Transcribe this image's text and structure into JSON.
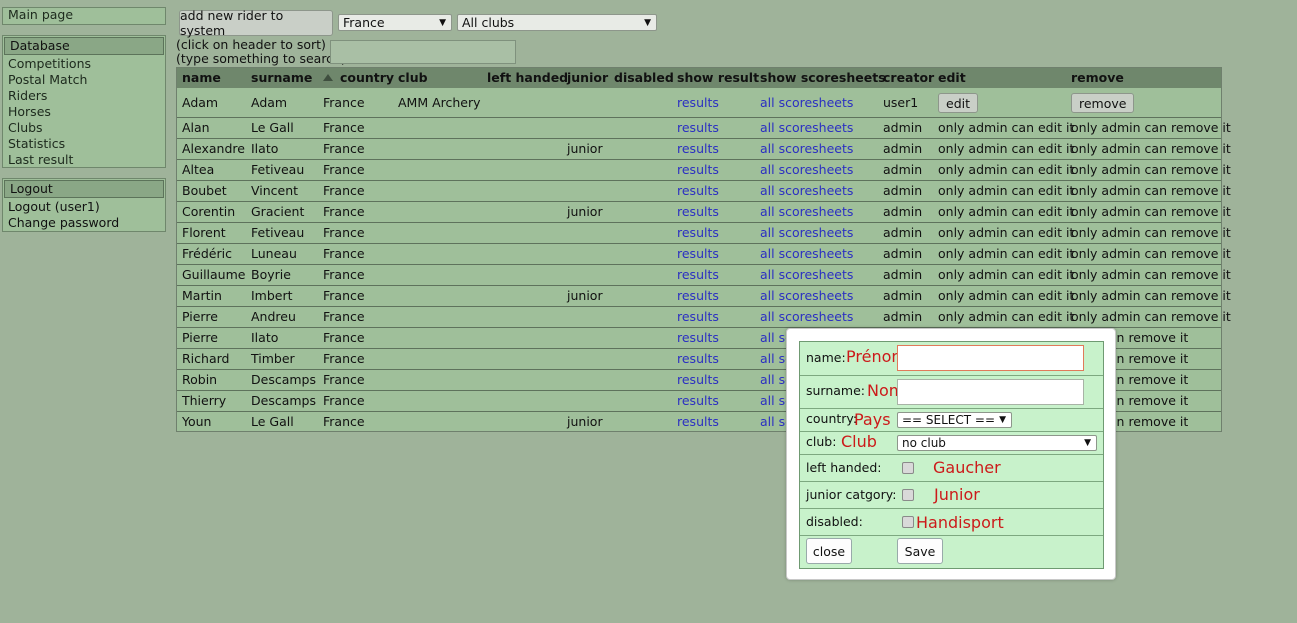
{
  "sidebar": {
    "main": {
      "label": "Main page"
    },
    "database": {
      "header": "Database",
      "items": [
        {
          "label": "Competitions"
        },
        {
          "label": "Postal Match"
        },
        {
          "label": "Riders"
        },
        {
          "label": "Horses"
        },
        {
          "label": "Clubs"
        },
        {
          "label": "Statistics"
        },
        {
          "label": "Last result"
        }
      ]
    },
    "account": {
      "header": "Logout",
      "items": [
        {
          "label": "Logout (user1)"
        },
        {
          "label": "Change password"
        }
      ]
    }
  },
  "toolbar": {
    "add_rider_label": "add new rider to system",
    "country_filter": "France",
    "club_filter": "All clubs",
    "sort_hint": "(click on header to sort)",
    "search_hint": "(type something to search)",
    "search_value": ""
  },
  "table": {
    "headers": {
      "name": "name",
      "surname": "surname",
      "country": "country",
      "club": "club",
      "left_handed": "left handed",
      "junior": "junior",
      "disabled": "disabled",
      "show_result": "show result",
      "show_scoresheets": "show scoresheets",
      "creator": "creator",
      "edit": "edit",
      "remove": "remove"
    },
    "rows": [
      {
        "name": "Adam",
        "surname": "Adam",
        "country": "France",
        "club": "AMM Archery",
        "junior": "",
        "result": "results",
        "scoresheets": "all scoresheets",
        "creator": "user1",
        "edit": "edit",
        "remove": "remove"
      },
      {
        "name": "Alan",
        "surname": "Le Gall",
        "country": "France",
        "club": "",
        "junior": "",
        "result": "results",
        "scoresheets": "all scoresheets",
        "creator": "admin",
        "edit": "only admin can edit it",
        "remove": "only admin can remove it"
      },
      {
        "name": "Alexandre",
        "surname": "Ilato",
        "country": "France",
        "club": "",
        "junior": "junior",
        "result": "results",
        "scoresheets": "all scoresheets",
        "creator": "admin",
        "edit": "only admin can edit it",
        "remove": "only admin can remove it"
      },
      {
        "name": "Altea",
        "surname": "Fetiveau",
        "country": "France",
        "club": "",
        "junior": "",
        "result": "results",
        "scoresheets": "all scoresheets",
        "creator": "admin",
        "edit": "only admin can edit it",
        "remove": "only admin can remove it"
      },
      {
        "name": "Boubet",
        "surname": "Vincent",
        "country": "France",
        "club": "",
        "junior": "",
        "result": "results",
        "scoresheets": "all scoresheets",
        "creator": "admin",
        "edit": "only admin can edit it",
        "remove": "only admin can remove it"
      },
      {
        "name": "Corentin",
        "surname": "Gracient",
        "country": "France",
        "club": "",
        "junior": "junior",
        "result": "results",
        "scoresheets": "all scoresheets",
        "creator": "admin",
        "edit": "only admin can edit it",
        "remove": "only admin can remove it"
      },
      {
        "name": "Florent",
        "surname": "Fetiveau",
        "country": "France",
        "club": "",
        "junior": "",
        "result": "results",
        "scoresheets": "all scoresheets",
        "creator": "admin",
        "edit": "only admin can edit it",
        "remove": "only admin can remove it"
      },
      {
        "name": "Frédéric",
        "surname": "Luneau",
        "country": "France",
        "club": "",
        "junior": "",
        "result": "results",
        "scoresheets": "all scoresheets",
        "creator": "admin",
        "edit": "only admin can edit it",
        "remove": "only admin can remove it"
      },
      {
        "name": "Guillaume",
        "surname": "Boyrie",
        "country": "France",
        "club": "",
        "junior": "",
        "result": "results",
        "scoresheets": "all scoresheets",
        "creator": "admin",
        "edit": "only admin can edit it",
        "remove": "only admin can remove it"
      },
      {
        "name": "Martin",
        "surname": "Imbert",
        "country": "France",
        "club": "",
        "junior": "junior",
        "result": "results",
        "scoresheets": "all scoresheets",
        "creator": "admin",
        "edit": "only admin can edit it",
        "remove": "only admin can remove it"
      },
      {
        "name": "Pierre",
        "surname": "Andreu",
        "country": "France",
        "club": "",
        "junior": "",
        "result": "results",
        "scoresheets": "all scoresheets",
        "creator": "admin",
        "edit": "only admin can edit it",
        "remove": "only admin can remove it"
      },
      {
        "name": "Pierre",
        "surname": "Ilato",
        "country": "France",
        "club": "",
        "junior": "",
        "result": "results",
        "scoresheets": "all sc",
        "creator": "",
        "edit": "",
        "remove": "imin can remove it"
      },
      {
        "name": "Richard",
        "surname": "Timber",
        "country": "France",
        "club": "",
        "junior": "",
        "result": "results",
        "scoresheets": "all sc",
        "creator": "",
        "edit": "",
        "remove": "imin can remove it"
      },
      {
        "name": "Robin",
        "surname": "Descamps",
        "country": "France",
        "club": "",
        "junior": "",
        "result": "results",
        "scoresheets": "all sc",
        "creator": "",
        "edit": "",
        "remove": "imin can remove it"
      },
      {
        "name": "Thierry",
        "surname": "Descamps",
        "country": "France",
        "club": "",
        "junior": "",
        "result": "results",
        "scoresheets": "all sc",
        "creator": "",
        "edit": "",
        "remove": "imin can remove it"
      },
      {
        "name": "Youn",
        "surname": "Le Gall",
        "country": "France",
        "club": "",
        "junior": "junior",
        "result": "results",
        "scoresheets": "all sc",
        "creator": "",
        "edit": "",
        "remove": "imin can remove it"
      }
    ]
  },
  "modal": {
    "name_label": "name:",
    "name_hint": "Prénom",
    "name_value": "",
    "surname_label": "surname:",
    "surname_hint": "Nom de famille",
    "surname_value": "",
    "country_label": "country:",
    "country_hint": "Pays",
    "country_value": "== SELECT ==",
    "club_label": "club:",
    "club_hint": "Club",
    "club_value": "no club",
    "left_handed_label": "left handed:",
    "left_handed_hint": "Gaucher",
    "junior_label": "junior catgory:",
    "junior_hint": "Junior",
    "disabled_label": "disabled:",
    "disabled_hint": "Handisport",
    "close_label": "close",
    "save_label": "Save"
  },
  "icons": {
    "dropdown": "triangle-down-icon",
    "sort": "sort-ascending-icon"
  }
}
